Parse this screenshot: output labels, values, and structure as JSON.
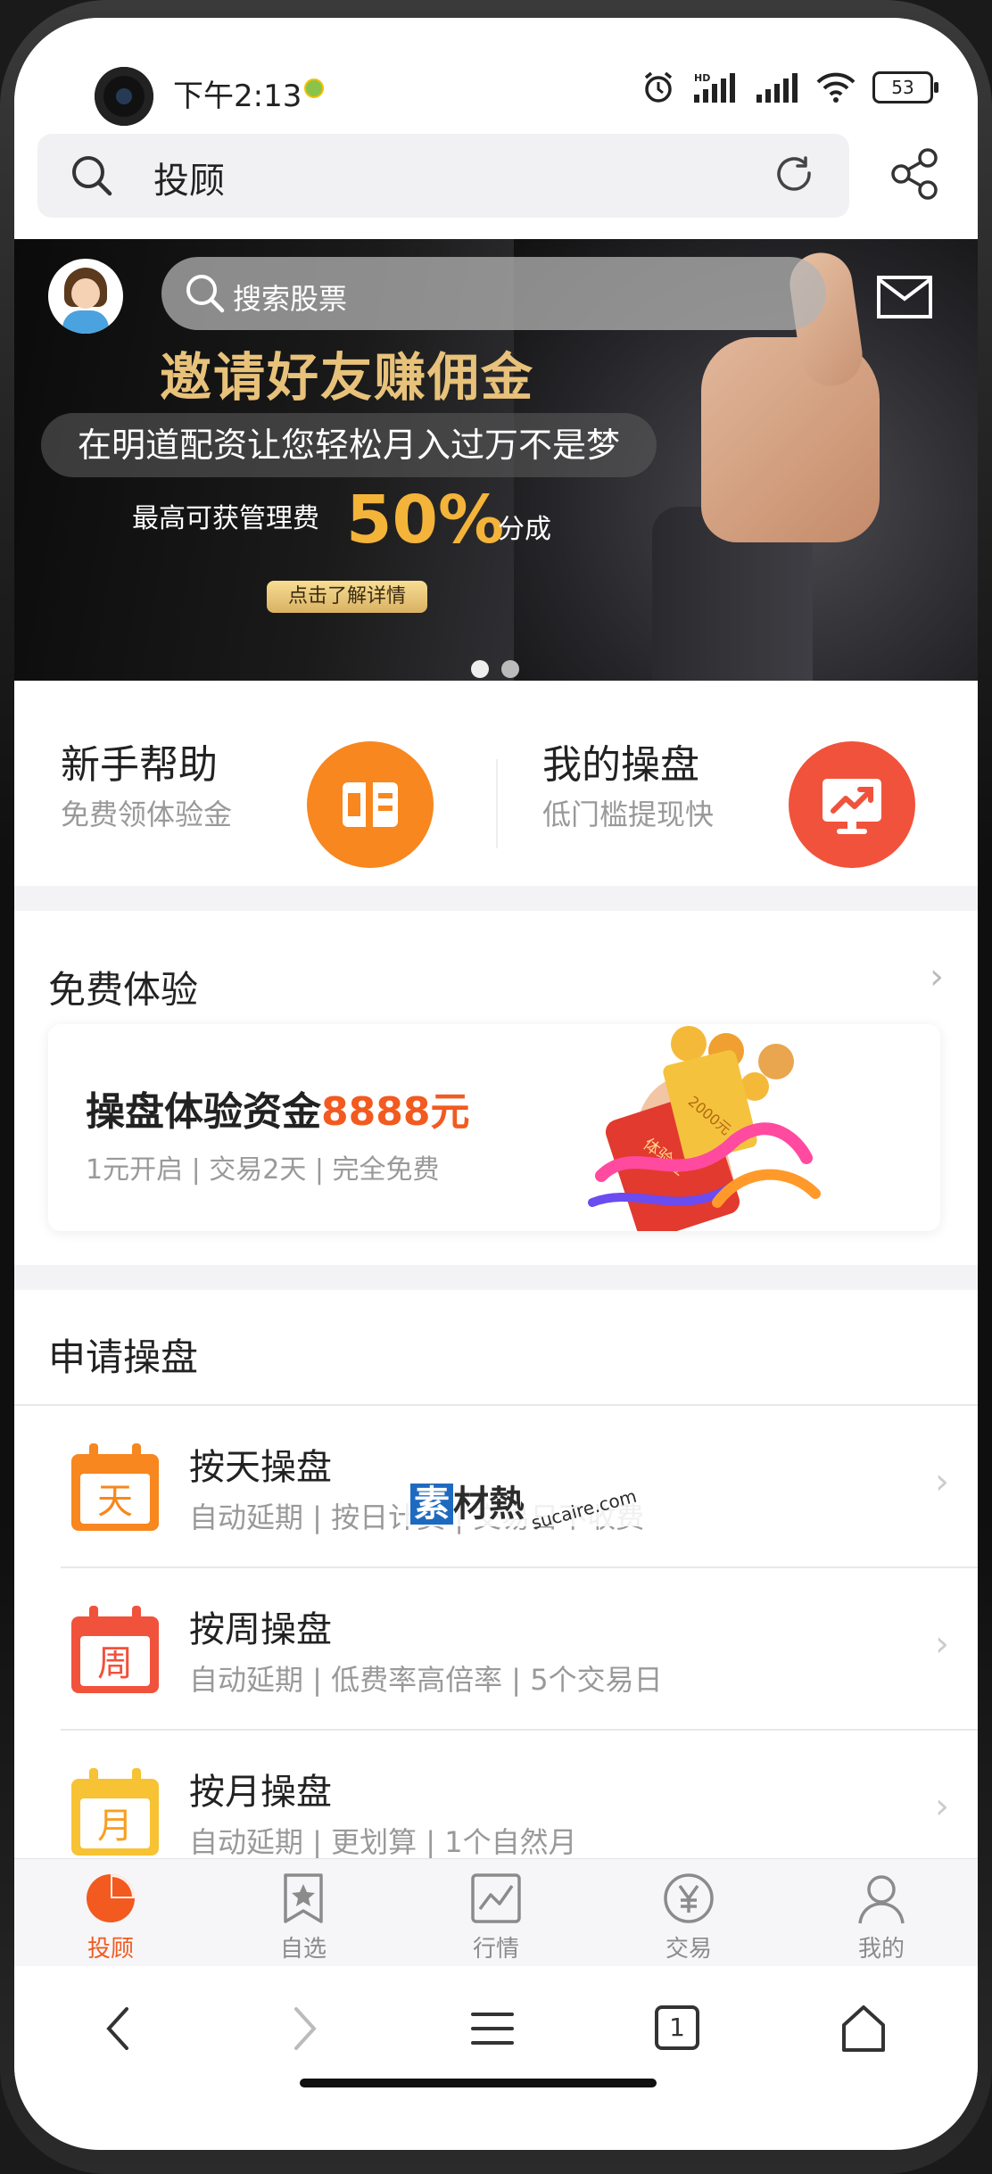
{
  "status_bar": {
    "time": "下午2:13",
    "battery": "53",
    "network": "HD"
  },
  "browser": {
    "url_text": "投顾"
  },
  "banner": {
    "search_placeholder": "搜索股票",
    "headline": "邀请好友赚佣金",
    "subline": "在明道配资让您轻松月入过万不是梦",
    "fee_prefix": "最高可获管理费",
    "fee_value": "50%",
    "fee_suffix": "分成",
    "detail_button": "点击了解详情"
  },
  "quick_entries": [
    {
      "title": "新手帮助",
      "subtitle": "免费领体验金",
      "icon": "book-icon"
    },
    {
      "title": "我的操盘",
      "subtitle": "低门槛提现快",
      "icon": "chart-screen-icon"
    }
  ],
  "free_experience": {
    "title": "免费体验",
    "card_title_prefix": "操盘体验资金",
    "card_title_amount": "8888元",
    "card_subtitle": "1元开启 | 交易2天 | 完全免费",
    "envelope_amount": "2000元",
    "envelope_label": "体验金"
  },
  "apply": {
    "title": "申请操盘",
    "items": [
      {
        "icon_char": "天",
        "title": "按天操盘",
        "subtitle": "自动延期 | 按日计费 | 交易日不收费"
      },
      {
        "icon_char": "周",
        "title": "按周操盘",
        "subtitle": "自动延期 | 低费率高倍率 | 5个交易日"
      },
      {
        "icon_char": "月",
        "title": "按月操盘",
        "subtitle": "自动延期 | 更划算 | 1个自然月"
      }
    ]
  },
  "watermark": {
    "first": "素",
    "rest": "材熱",
    "url": "sucaire.com"
  },
  "tabbar": {
    "active_index": 0,
    "tabs": [
      {
        "label": "投顾",
        "icon": "pie-icon"
      },
      {
        "label": "自选",
        "icon": "bookmark-star-icon"
      },
      {
        "label": "行情",
        "icon": "line-chart-icon"
      },
      {
        "label": "交易",
        "icon": "yen-icon"
      },
      {
        "label": "我的",
        "icon": "user-icon"
      }
    ]
  },
  "browser_nav": {
    "tab_count": "1"
  },
  "colors": {
    "accent": "#f25a1f",
    "orange": "#f7871e",
    "red": "#f1523b",
    "yellow": "#f7c233"
  }
}
